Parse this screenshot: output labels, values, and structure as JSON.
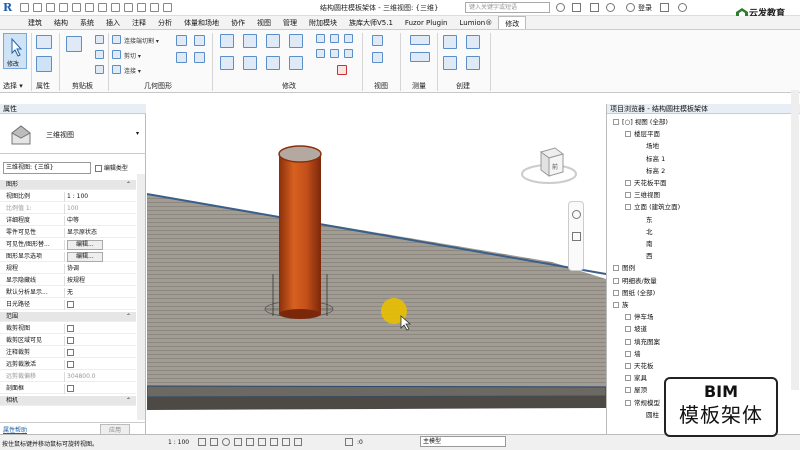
{
  "title_bar": {
    "doc_title": "结构圆柱模板架体 - 三维视图: {三维}",
    "search_placeholder": "键入关键字或短语",
    "login": "登录"
  },
  "tabs": [
    "建筑",
    "结构",
    "系统",
    "插入",
    "注释",
    "分析",
    "体量和场地",
    "协作",
    "视图",
    "管理",
    "附加模块",
    "族库大师V5.1",
    "Fuzor Plugin",
    "Lumion®",
    "修改"
  ],
  "active_tab": "修改",
  "ribbon": {
    "modify_label": "修改",
    "select_group": "选择 ▾",
    "properties_group": "属性",
    "clipboard_group": "剪贴板",
    "geometry_group": "几何图形",
    "modify_group": "修改",
    "view_group": "视图",
    "measure_group": "测量",
    "create_group": "创建",
    "geo_items": [
      "连接端切割 ▾",
      "剪切 ▾",
      "连接 ▾"
    ]
  },
  "properties": {
    "header": "属性",
    "type_name": "三维视图",
    "view_selector": "三维视图: {三维}",
    "edit_type": "编辑类型",
    "rows": [
      {
        "k": "图形",
        "v": "",
        "cat": true
      },
      {
        "k": "视图比例",
        "v": "1 : 100"
      },
      {
        "k": "比例值 1:",
        "v": "100",
        "grey": true
      },
      {
        "k": "详细程度",
        "v": "中等"
      },
      {
        "k": "零件可见性",
        "v": "显示原状态"
      },
      {
        "k": "可见性/图形替...",
        "v": "编辑...",
        "btn": true
      },
      {
        "k": "图形显示选项",
        "v": "编辑...",
        "btn": true
      },
      {
        "k": "规程",
        "v": "协调"
      },
      {
        "k": "显示隐藏线",
        "v": "按规程"
      },
      {
        "k": "默认分析显示...",
        "v": "无"
      },
      {
        "k": "日光路径",
        "v": "",
        "chk": true
      },
      {
        "k": "范围",
        "v": "",
        "cat": true
      },
      {
        "k": "裁剪视图",
        "v": "",
        "chk": true
      },
      {
        "k": "裁剪区域可见",
        "v": "",
        "chk": true
      },
      {
        "k": "注释裁剪",
        "v": "",
        "chk": true
      },
      {
        "k": "远剪裁激活",
        "v": "",
        "chk": true
      },
      {
        "k": "远剪裁偏移",
        "v": "304800.0",
        "grey": true
      },
      {
        "k": "剖面框",
        "v": "",
        "chk": true
      },
      {
        "k": "相机",
        "v": "",
        "cat": true
      }
    ],
    "help_link": "属性帮助",
    "apply": "应用"
  },
  "browser": {
    "header": "项目浏览器 - 结构圆柱模板架体",
    "nodes": [
      {
        "t": "[○] 视图 (全部)",
        "d": 0
      },
      {
        "t": "楼层平面",
        "d": 1
      },
      {
        "t": "场地",
        "d": 2
      },
      {
        "t": "标高 1",
        "d": 2
      },
      {
        "t": "标高 2",
        "d": 2
      },
      {
        "t": "天花板平面",
        "d": 1
      },
      {
        "t": "三维视图",
        "d": 1
      },
      {
        "t": "立面 (建筑立面)",
        "d": 1
      },
      {
        "t": "东",
        "d": 2
      },
      {
        "t": "北",
        "d": 2
      },
      {
        "t": "南",
        "d": 2
      },
      {
        "t": "西",
        "d": 2
      },
      {
        "t": "图例",
        "d": 0
      },
      {
        "t": "明细表/数量",
        "d": 0
      },
      {
        "t": "图纸 (全部)",
        "d": 0
      },
      {
        "t": "族",
        "d": 0
      },
      {
        "t": "停车场",
        "d": 1
      },
      {
        "t": "坡道",
        "d": 1
      },
      {
        "t": "填充图案",
        "d": 1
      },
      {
        "t": "墙",
        "d": 1
      },
      {
        "t": "天花板",
        "d": 1
      },
      {
        "t": "家具",
        "d": 1
      },
      {
        "t": "屋顶",
        "d": 1
      },
      {
        "t": "常规模型",
        "d": 1
      },
      {
        "t": "圆柱",
        "d": 2
      }
    ]
  },
  "viewcube": {
    "face_label": "前"
  },
  "status": {
    "scale": "1 : 100",
    "hint": "按住鼠标键并移动鼠标可旋转视图。",
    "model": "主模型",
    "zero": ":0"
  },
  "watermark": {
    "line1": "BIM",
    "line2": "模板架体"
  },
  "brand": {
    "name": "云发教育",
    "sub": "用知识 做事者 成未来"
  },
  "colors": {
    "column": "#c4501a",
    "slab": "#a09b93",
    "highlight": "#e8c000",
    "accent": "#1d5fa8"
  }
}
